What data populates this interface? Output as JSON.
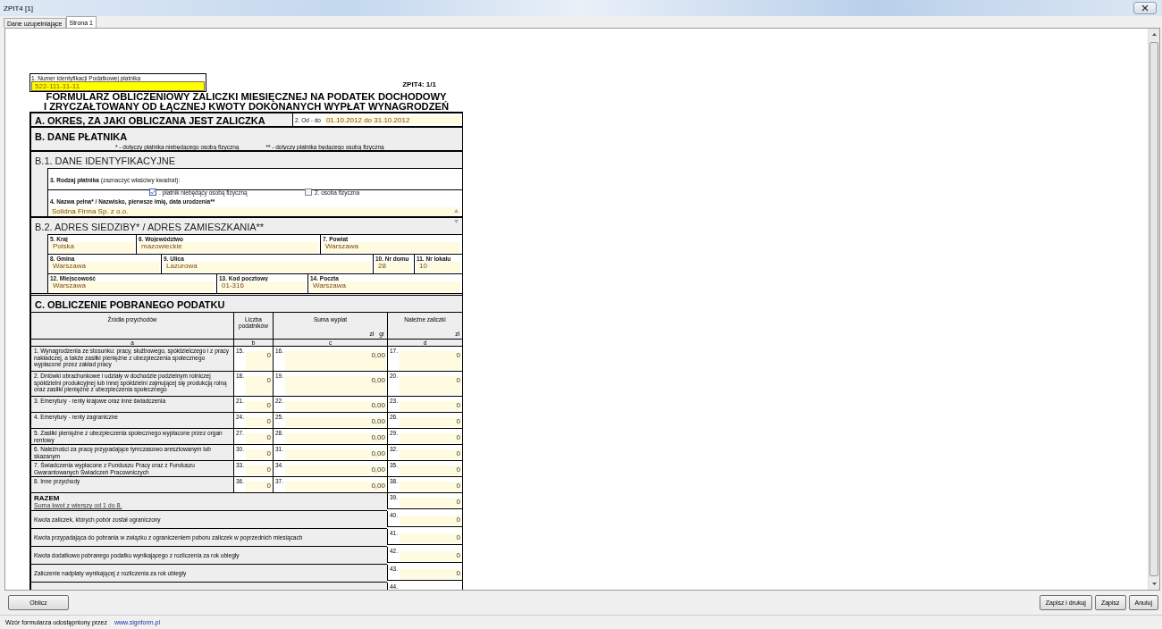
{
  "window": {
    "title": "ZPIT4 [1]"
  },
  "tabs": [
    {
      "label": "Dane uzupełniające",
      "selected": false
    },
    {
      "label": "Strona 1",
      "selected": true
    }
  ],
  "form": {
    "nip": {
      "label": "1. Numer Identyfikacji Podatkowej płatnika",
      "value": "522-111-11-11"
    },
    "page_id": "ZPIT4: 1/1",
    "title_lines": [
      "FORMULARZ OBLICZENIOWY ZALICZKI MIESIĘCZNEJ NA PODATEK DOCHODOWY",
      "I ZRYCZAŁTOWANY OD ŁĄCZNEJ KWOTY DOKONANYCH WYPŁAT WYNAGRODZEŃ"
    ],
    "section_a": {
      "heading": "A. OKRES, ZA JAKI OBLICZANA JEST ZALICZKA",
      "label": "2. Od - do",
      "value": "01.10.2012 do 31.10.2012"
    },
    "section_b": {
      "heading": "B. DANE PŁATNIKA",
      "notes": [
        "* - dotyczy płatnika niebędącego osobą fizyczną",
        "** - dotyczy płatnika będącego osobą fizyczną"
      ]
    },
    "b1": {
      "heading": "B.1. DANE IDENTYFIKACYJNE",
      "type_label": "**3. Rodzaj płatnika** (zaznaczyć właściwy kwadrat):",
      "options": [
        {
          "label": ". płatnik niebędący osobą fizyczną",
          "checked": true
        },
        {
          "label": "2. osoba fizyczna",
          "checked": false
        }
      ],
      "name_label": "4. Nazwa pełna* / Nazwisko, pierwsze imię, data urodzenia**",
      "name_value": "Solidna Firma Sp. z o.o."
    },
    "b2": {
      "heading": "B.2. ADRES SIEDZIBY* / ADRES ZAMIESZKANIA**",
      "rows": [
        [
          {
            "label": "5. Kraj",
            "value": "Polska"
          },
          {
            "label": "6. Województwo",
            "value": "mazowieckie"
          },
          {
            "label": "7. Powiat",
            "value": "Warszawa"
          }
        ],
        [
          {
            "label": "8. Gmina",
            "value": "Warszawa"
          },
          {
            "label": "9. Ulica",
            "value": "Lazurowa"
          },
          {
            "label": "10. Nr domu",
            "value": "28"
          },
          {
            "label": "11. Nr lokalu",
            "value": "10"
          }
        ],
        [
          {
            "label": "12. Miejscowość",
            "value": "Warszawa"
          },
          {
            "label": "13. Kod pocztowy",
            "value": "01-316"
          },
          {
            "label": "14. Poczta",
            "value": "Warszawa"
          }
        ]
      ]
    },
    "c": {
      "heading": "C. OBLICZENIE POBRANEGO PODATKU",
      "columns": [
        {
          "title": "Źródła przychodów",
          "letter": "a"
        },
        {
          "title": "Liczba podatników",
          "letter": "b"
        },
        {
          "title": "Suma wypłat",
          "units": [
            "zł",
            "gr"
          ],
          "letter": "c"
        },
        {
          "title": "Należne zaliczki",
          "units": [
            "zł"
          ],
          "letter": "d"
        }
      ],
      "rows": [
        {
          "cells": [
            {
              "text": "1. Wynagrodzenia ze stosunku: pracy, służbowego, spółdzielczego i z pracy nakładczej, a także zasiłki pieniężne z ubezpieczenia społecznego wypłacone przez zakład pracy"
            },
            {
              "num": "15.",
              "value": "0"
            },
            {
              "num": "16.",
              "value": "0,00"
            },
            {
              "num": "17.",
              "value": "0"
            }
          ]
        },
        {
          "cells": [
            {
              "text": "2. Dniówki obrachunkowe i udziały w dochodzie podzielnym rolniczej spółdzielni produkcyjnej lub innej spółdzielni zajmującej się produkcją rolną oraz zasiłki pieniężne z ubezpieczenia społecznego"
            },
            {
              "num": "18.",
              "value": "0"
            },
            {
              "num": "19.",
              "value": "0,00"
            },
            {
              "num": "20.",
              "value": "0"
            }
          ]
        },
        {
          "cells": [
            {
              "text": "3. Emerytury - renty krajowe oraz inne świadczenia"
            },
            {
              "num": "21.",
              "value": "0"
            },
            {
              "num": "22.",
              "value": "0,00"
            },
            {
              "num": "23.",
              "value": "0"
            }
          ]
        },
        {
          "cells": [
            {
              "text": "4. Emerytury - renty zagraniczne"
            },
            {
              "num": "24.",
              "value": "0"
            },
            {
              "num": "25.",
              "value": "0,00"
            },
            {
              "num": "26.",
              "value": "0"
            }
          ]
        },
        {
          "cells": [
            {
              "text": "5. Zasiłki pieniężne z ubezpieczenia społecznego wypłacone przez organ rentowy"
            },
            {
              "num": "27.",
              "value": "0"
            },
            {
              "num": "28.",
              "value": "0,00"
            },
            {
              "num": "29.",
              "value": "0"
            }
          ]
        },
        {
          "cells": [
            {
              "text": "6. Należności za pracę przypadające tymczasowo aresztowanym lub skazanym"
            },
            {
              "num": "30.",
              "value": "0"
            },
            {
              "num": "31.",
              "value": "0,00"
            },
            {
              "num": "32.",
              "value": "0"
            }
          ]
        },
        {
          "cells": [
            {
              "text": "7. Świadczenia wypłacone z Funduszu Pracy oraz z Funduszu Gwarantowanych Świadczeń Pracowniczych"
            },
            {
              "num": "33.",
              "value": "0"
            },
            {
              "num": "34.",
              "value": "0,00"
            },
            {
              "num": "35.",
              "value": "0"
            }
          ]
        },
        {
          "cells": [
            {
              "text": "8. Inne przychody"
            },
            {
              "num": "36.",
              "value": "0"
            },
            {
              "num": "37.",
              "value": "0,00"
            },
            {
              "num": "38.",
              "value": "0"
            }
          ]
        }
      ],
      "totals": [
        {
          "label": "RAZEM",
          "sublabel": "Suma kwot z wierszy od 1 do 8.",
          "num": "39.",
          "value": "0"
        },
        {
          "label": "Kwota zaliczek, których pobór został ograniczony",
          "num": "40.",
          "value": "0"
        },
        {
          "label": "Kwota przypadająca do pobrania w związku z ograniczeniem poboru zaliczek w poprzednich miesiącach",
          "num": "41.",
          "value": "0"
        },
        {
          "label": "Kwota dodatkowo pobranego podatku wynikającego z rozliczenia za rok ubiegły",
          "num": "42.",
          "value": "0"
        },
        {
          "label": "Zaliczenie nadpłaty wynikającej z rozliczenia za rok ubiegły",
          "num": "43.",
          "value": "0"
        },
        {
          "num": "44."
        }
      ]
    }
  },
  "buttons_left": [
    "Oblicz"
  ],
  "buttons_right": [
    "Zapisz i drukuj",
    "Zapisz",
    "Anuluj"
  ],
  "status_bar": {
    "text": "Wzór formularza udostępniony przez",
    "link": "www.signform.pl"
  }
}
